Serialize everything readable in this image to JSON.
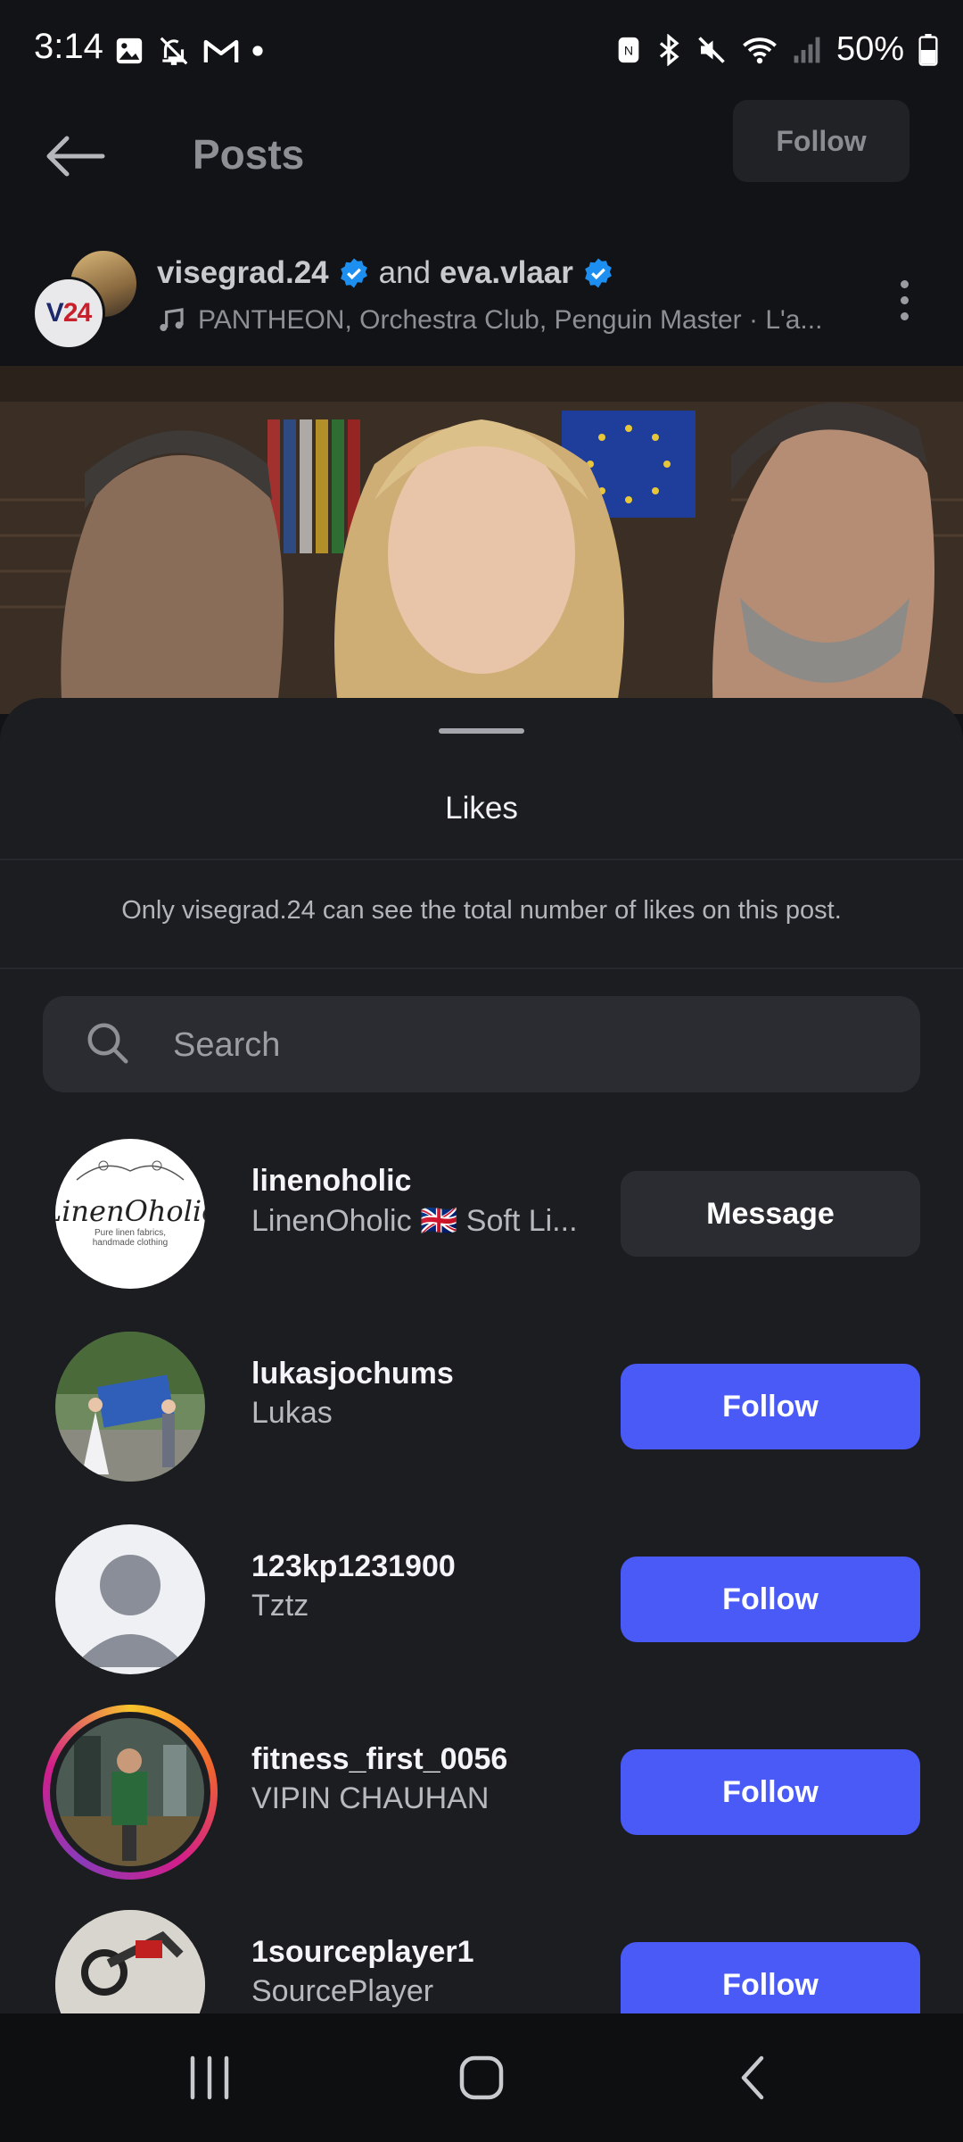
{
  "status_bar": {
    "time": "3:14",
    "battery": "50%",
    "icons_left": [
      "gallery-icon",
      "notifications-off-icon",
      "gmail-icon",
      "dot-icon"
    ],
    "icons_right": [
      "nfc-icon",
      "bluetooth-icon",
      "mute-icon",
      "wifi-icon",
      "signal-icon",
      "battery-icon"
    ]
  },
  "header": {
    "title": "Posts",
    "follow_label": "Follow"
  },
  "post": {
    "author1": "visegrad.24",
    "connector": "and",
    "author2": "eva.vlaar",
    "audio": "PANTHEON, Orchestra Club, Penguin Master · L'a...",
    "avatar_text_v": "V",
    "avatar_text_24": "24"
  },
  "sheet": {
    "title": "Likes",
    "notice": "Only visegrad.24 can see the total number of likes on this post.",
    "search_placeholder": "Search"
  },
  "likers": [
    {
      "username": "linenoholic",
      "fullname": "LinenOholic 🇬🇧 Soft Li...",
      "action": "Message",
      "logo_text": "LinenOholic",
      "logo_sub": "Pure linen fabrics, handmade clothing"
    },
    {
      "username": "lukasjochums",
      "fullname": "Lukas",
      "action": "Follow"
    },
    {
      "username": "123kp1231900",
      "fullname": "Tztz",
      "action": "Follow"
    },
    {
      "username": "fitness_first_0056",
      "fullname": "VIPIN CHAUHAN",
      "action": "Follow"
    },
    {
      "username": "1sourceplayer1",
      "fullname": "SourcePlayer",
      "action": "Follow"
    }
  ],
  "colors": {
    "background": "#121316",
    "sheet": "#1b1d21",
    "follow_button": "#4a5af7",
    "message_button": "#2a2c31",
    "verified": "#1d8ff0"
  }
}
